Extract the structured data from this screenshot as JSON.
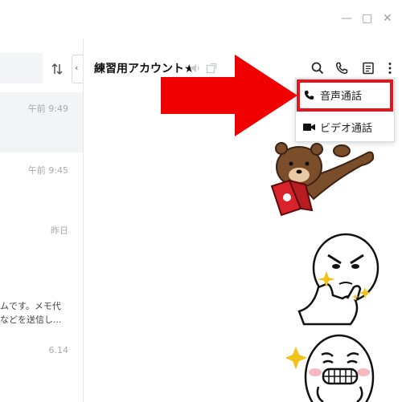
{
  "window": {
    "controls": [
      "minimize",
      "maximize",
      "close"
    ],
    "minimize_glyph": "—",
    "maximize_glyph": "□",
    "close_glyph": "✕"
  },
  "left_pane": {
    "chats": [
      {
        "time": "午前 9:49",
        "preview_lines": [],
        "selected": true
      },
      {
        "time": "午前 9:45",
        "preview_lines": [],
        "selected": false
      },
      {
        "time": "昨日",
        "preview_lines": [],
        "selected": false
      },
      {
        "time": "6.14",
        "preview_lines": [
          "ムです。メモ代",
          "などを送信し..."
        ],
        "selected": false
      }
    ]
  },
  "chat_header": {
    "title": "練習用アカウント★",
    "icons": [
      "mute-icon",
      "external-window-icon",
      "search-icon",
      "phone-icon",
      "notes-icon",
      "more-icon"
    ]
  },
  "call_menu": {
    "items": [
      {
        "label": "音声通話",
        "icon": "phone-icon"
      },
      {
        "label": "ビデオ通話",
        "icon": "video-camera-icon"
      }
    ]
  },
  "colors": {
    "highlight": "#e8141b",
    "arrow": "#f00000",
    "sticker_brown": "#7a4d2b",
    "sticker_book": "#d8232a"
  }
}
